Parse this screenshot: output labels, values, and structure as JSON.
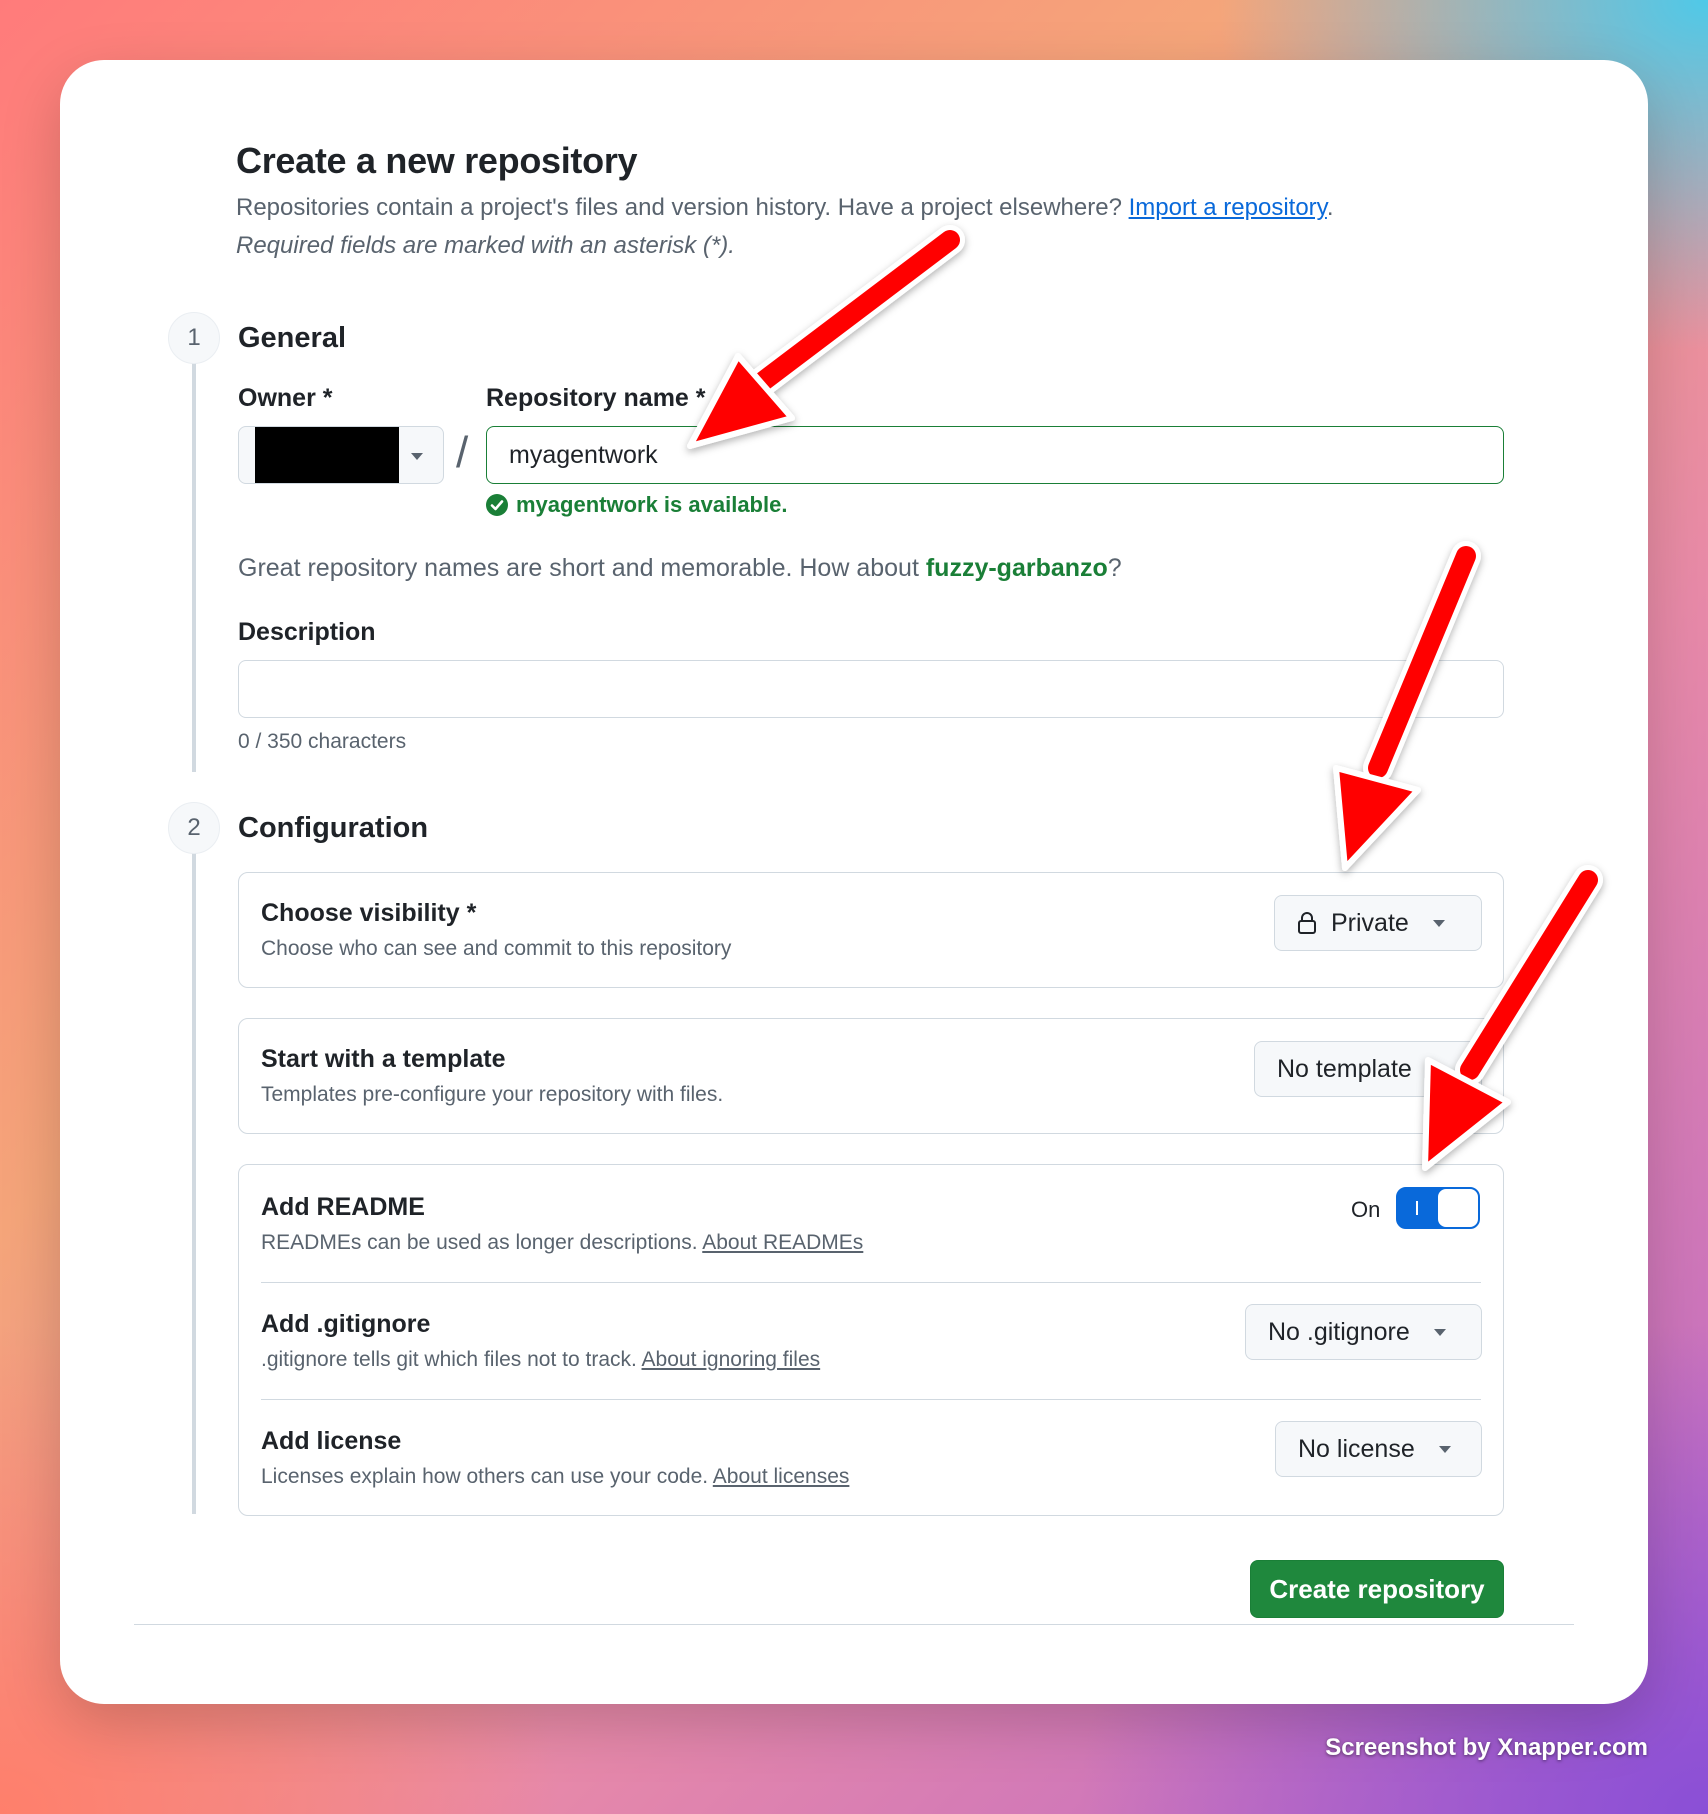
{
  "header": {
    "title": "Create a new repository",
    "intro": "Repositories contain a project's files and version history. Have a project elsewhere?",
    "import_link": "Import a repository",
    "required_note": "Required fields are marked with an asterisk (*)."
  },
  "general": {
    "step": "1",
    "title": "General",
    "owner_label": "Owner *",
    "repo_label": "Repository name *",
    "repo_value": "myagentwork",
    "availability": "myagentwork is available.",
    "suggest_text": "Great repository names are short and memorable. How about",
    "suggestion": "fuzzy-garbanzo",
    "description_label": "Description",
    "description_value": "",
    "char_count": "0 / 350 characters"
  },
  "configuration": {
    "step": "2",
    "title": "Configuration",
    "visibility": {
      "title": "Choose visibility *",
      "desc": "Choose who can see and commit to this repository",
      "value": "Private"
    },
    "template": {
      "title": "Start with a template",
      "desc": "Templates pre-configure your repository with files.",
      "value": "No template"
    },
    "readme": {
      "title": "Add README",
      "desc": "READMEs can be used as longer descriptions.",
      "link": "About READMEs",
      "toggle_label": "On",
      "toggle_state": "on"
    },
    "gitignore": {
      "title": "Add .gitignore",
      "desc": ".gitignore tells git which files not to track.",
      "link": "About ignoring files",
      "value": "No .gitignore"
    },
    "license": {
      "title": "Add license",
      "desc": "Licenses explain how others can use your code.",
      "link": "About licenses",
      "value": "No license"
    }
  },
  "actions": {
    "create_label": "Create repository"
  },
  "watermark": "Screenshot by Xnapper.com",
  "colors": {
    "accent_green": "#1f883d",
    "link_blue": "#0969da",
    "annotation_red": "#ff0000"
  }
}
